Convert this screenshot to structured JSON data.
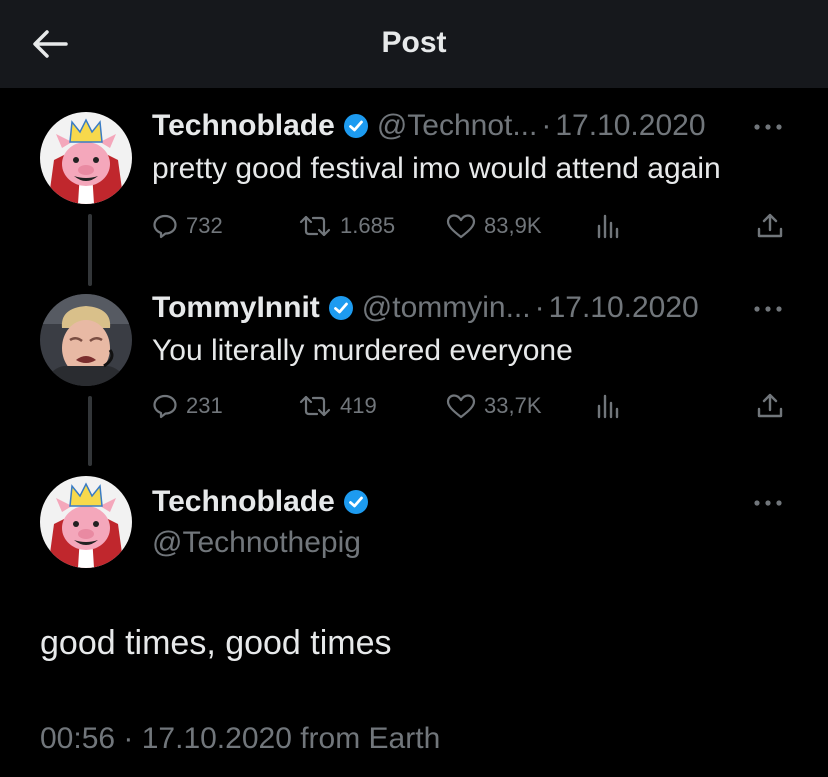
{
  "header": {
    "title": "Post"
  },
  "icons": {
    "back": "arrow-left-icon",
    "verified": "verified-badge-icon",
    "more": "more-dots-icon",
    "reply": "reply-icon",
    "retweet": "retweet-icon",
    "like": "heart-icon",
    "views": "views-icon",
    "share": "share-icon"
  },
  "colors": {
    "background": "#000000",
    "topbar": "#16181c",
    "text": "#e7e9ea",
    "muted": "#71767b",
    "verified": "#1d9bf0"
  },
  "thread": [
    {
      "name": "Technoblade",
      "handle": "@Technot...",
      "separator": "·",
      "date": "17.10.2020",
      "text": "pretty good festival imo would attend again",
      "replies": "732",
      "retweets": "1.685",
      "likes": "83,9K"
    },
    {
      "name": "TommyInnit",
      "handle": "@tommyin...",
      "separator": "·",
      "date": "17.10.2020",
      "text": "You literally murdered everyone",
      "replies": "231",
      "retweets": "419",
      "likes": "33,7K"
    }
  ],
  "main": {
    "name": "Technoblade",
    "handle": "@Technothepig",
    "text": "good times, good times",
    "meta": "00:56 · 17.10.2020 from Earth"
  }
}
